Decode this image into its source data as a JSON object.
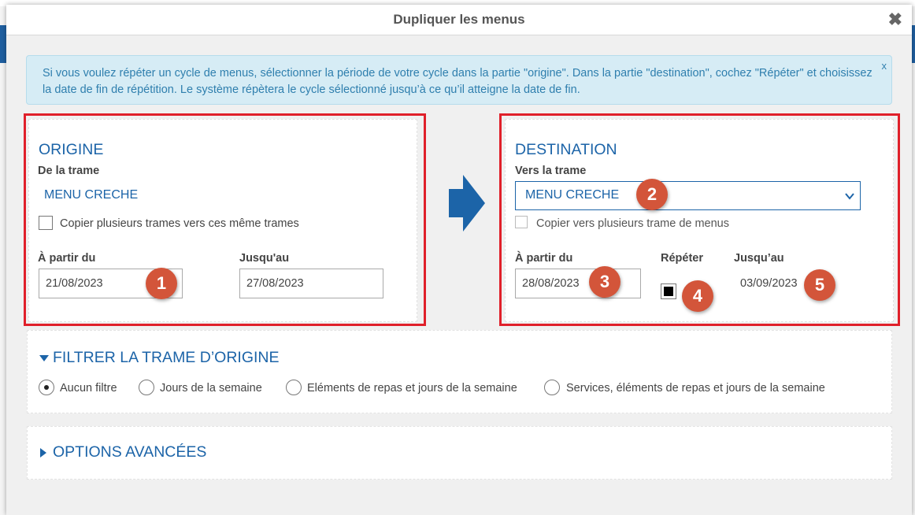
{
  "modal": {
    "title": "Dupliquer les menus",
    "close": "✖"
  },
  "info": {
    "text": "Si vous voulez répéter un cycle de menus, sélectionner la période de votre cycle dans la partie \"origine\". Dans la partie \"destination\", cochez \"Répéter\" et choisissez la date de fin de répétition. Le système répètera le cycle sélectionné jusqu’à ce qu’il atteigne la date de fin.",
    "close": "x"
  },
  "origin": {
    "title": "ORIGINE",
    "frame_label": "De la trame",
    "frame_value": "MENU CRECHE",
    "copy_label": "Copier plusieurs trames vers ces même trames",
    "from_label": "À partir du",
    "from_value": "21/08/2023",
    "to_label": "Jusqu'au",
    "to_value": "27/08/2023"
  },
  "destination": {
    "title": "DESTINATION",
    "frame_label": "Vers la trame",
    "frame_value": "MENU CRECHE",
    "copy_label": "Copier vers plusieurs trame de menus",
    "from_label": "À partir du",
    "from_value": "28/08/2023",
    "repeat_label": "Répéter",
    "to_label": "Jusqu’au",
    "to_value": "03/09/2023"
  },
  "badges": [
    "1",
    "2",
    "3",
    "4",
    "5"
  ],
  "filter": {
    "title": "FILTRER LA TRAME D’ORIGINE",
    "options": [
      "Aucun filtre",
      "Jours de la semaine",
      "Eléments de repas et jours de la semaine",
      "Services, éléments de repas et jours de la semaine"
    ],
    "selected": "Aucun filtre"
  },
  "advanced": {
    "title": "OPTIONS AVANCÉES"
  },
  "colors": {
    "accent": "#1c64a8",
    "highlight": "#e0202a",
    "badge": "#d3553a",
    "info_bg": "#d6ecf5"
  }
}
